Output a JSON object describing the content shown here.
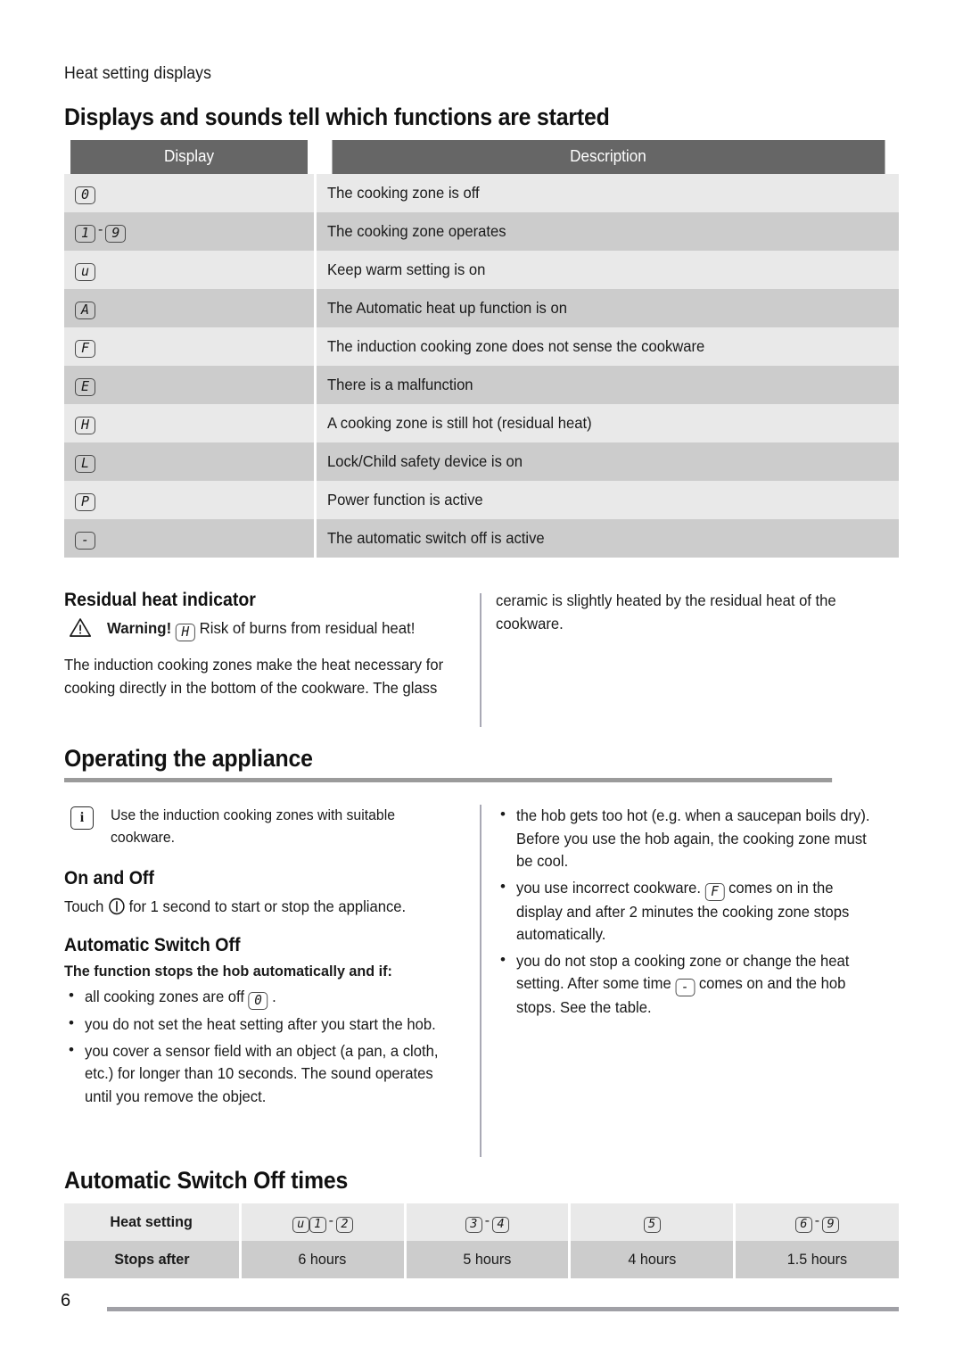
{
  "page": {
    "kicker": "Heat setting displays",
    "number": "6"
  },
  "display_table": {
    "title": "Displays and sounds tell which functions are started",
    "headers": {
      "display": "Display",
      "description": "Description"
    },
    "rows": [
      {
        "symbols": [
          "0"
        ],
        "range": false,
        "description": "The cooking zone is off"
      },
      {
        "symbols": [
          "1",
          "9"
        ],
        "range": true,
        "description": "The cooking zone operates"
      },
      {
        "symbols": [
          "u"
        ],
        "range": false,
        "description": "Keep warm setting is on"
      },
      {
        "symbols": [
          "A"
        ],
        "range": false,
        "description": "The Automatic heat up function is on"
      },
      {
        "symbols": [
          "F"
        ],
        "range": false,
        "description": "The induction cooking zone does not sense the cookware"
      },
      {
        "symbols": [
          "E"
        ],
        "range": false,
        "description": "There is a malfunction"
      },
      {
        "symbols": [
          "H"
        ],
        "range": false,
        "description": "A cooking zone is still hot (residual heat)"
      },
      {
        "symbols": [
          "L"
        ],
        "range": false,
        "description": "Lock/Child safety device is on"
      },
      {
        "symbols": [
          "P"
        ],
        "range": false,
        "description": "Power function is active"
      },
      {
        "symbols": [
          "-"
        ],
        "range": false,
        "description": "The automatic switch off is active"
      }
    ]
  },
  "residual": {
    "heading": "Residual heat indicator",
    "warning_label": "Warning!",
    "warning_symbol": "H",
    "warning_text": "Risk of burns from residual heat!",
    "paragraph_left": "The induction cooking zones make the heat necessary for cooking directly in the bottom of the cookware. The glass",
    "paragraph_right": "ceramic is slightly heated by the residual heat of the cookware."
  },
  "operating": {
    "title": "Operating the appliance",
    "note_icon": "info-icon",
    "note_text": "Use the induction cooking zones with suitable cookware.",
    "on_off": {
      "heading": "On and Off",
      "text_before": "Touch",
      "icon": "power-icon",
      "text_after": "for 1 second to start or stop the appliance."
    },
    "auto_switch_off": {
      "heading": "Automatic Switch Off",
      "lead": "The function stops the hob automatically and if:",
      "bullets_left": [
        {
          "before": "all cooking zones are off",
          "symbol": "0",
          "after": "."
        },
        {
          "before": "you do not set the heat setting after you start the hob.",
          "symbol": null,
          "after": ""
        },
        {
          "before": "you cover a sensor field with an object (a pan, a cloth, etc.) for longer than 10 seconds. The sound operates until you remove the object.",
          "symbol": null,
          "after": ""
        }
      ],
      "bullets_right": [
        {
          "before": "the hob gets too hot (e.g. when a saucepan boils dry). Before you use the hob again, the cooking zone must be cool.",
          "symbol": null,
          "after": ""
        },
        {
          "before": "you use incorrect cookware.",
          "symbol": "F",
          "after": "comes on in the display and after 2 minutes the cooking zone stops automatically."
        },
        {
          "before": "you do not stop a cooking zone or change the heat setting. After some time",
          "symbol": "-",
          "after": "comes on and the hob stops. See the table."
        }
      ]
    }
  },
  "times_table": {
    "title": "Automatic Switch Off times",
    "row_labels": {
      "heat_setting": "Heat setting",
      "stops_after": "Stops after"
    },
    "columns": [
      {
        "symbols": [
          "u",
          "1",
          "2"
        ],
        "layout": "u-range",
        "stops_after": "6 hours"
      },
      {
        "symbols": [
          "3",
          "4"
        ],
        "layout": "range",
        "stops_after": "5 hours"
      },
      {
        "symbols": [
          "5"
        ],
        "layout": "single",
        "stops_after": "4 hours"
      },
      {
        "symbols": [
          "6",
          "9"
        ],
        "layout": "range",
        "stops_after": "1.5 hours"
      }
    ]
  },
  "colors": {
    "header_bg": "#666666",
    "row_light": "#e9e9e9",
    "row_dark": "#cccccc",
    "rule": "#9b9b9b",
    "divider": "#a9a9b5",
    "text": "#1a1a1a"
  }
}
